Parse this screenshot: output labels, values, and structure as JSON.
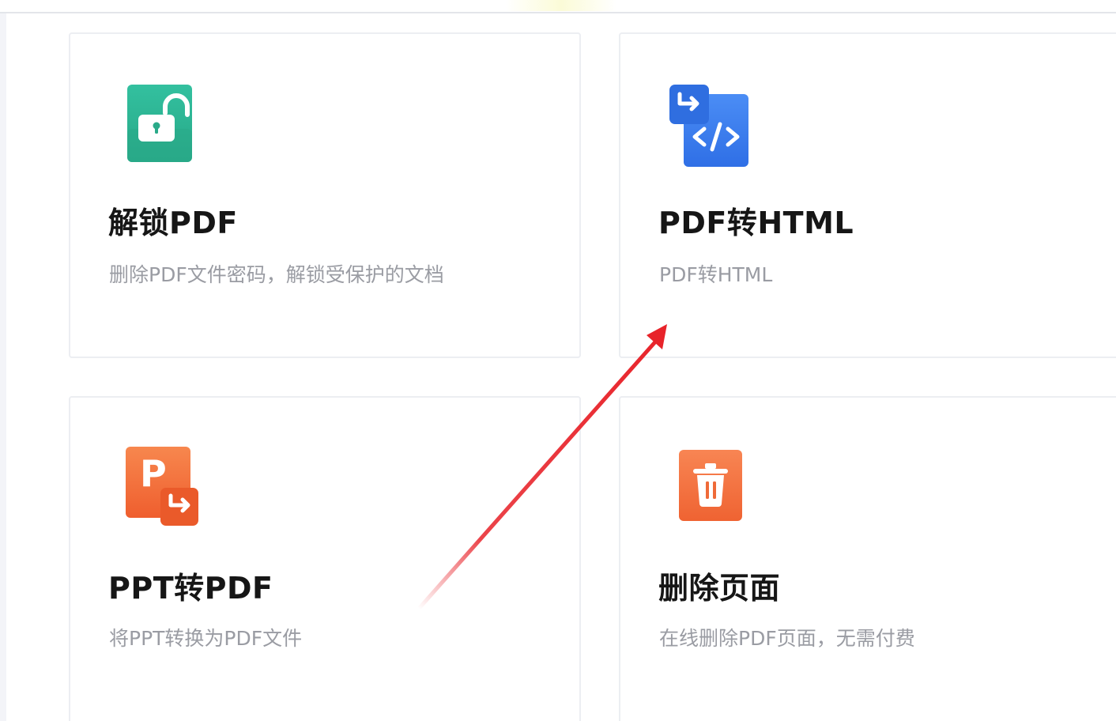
{
  "cards": [
    {
      "title": "解锁PDF",
      "description": "删除PDF文件密码，解锁受保护的文档",
      "icon": "unlock-icon",
      "color": "#2eb898"
    },
    {
      "title": "PDF转HTML",
      "description": "PDF转HTML",
      "icon": "code-convert-icon",
      "color": "#3a7df0"
    },
    {
      "title": "PPT转PDF",
      "description": "将PPT转换为PDF文件",
      "icon": "ppt-convert-icon",
      "color": "#f26a3a"
    },
    {
      "title": "删除页面",
      "description": "在线删除PDF页面，无需付费",
      "icon": "trash-icon",
      "color": "#f26a3a"
    }
  ],
  "annotation": {
    "type": "red-arrow",
    "color": "#e8232a",
    "target": "PDF转HTML"
  }
}
